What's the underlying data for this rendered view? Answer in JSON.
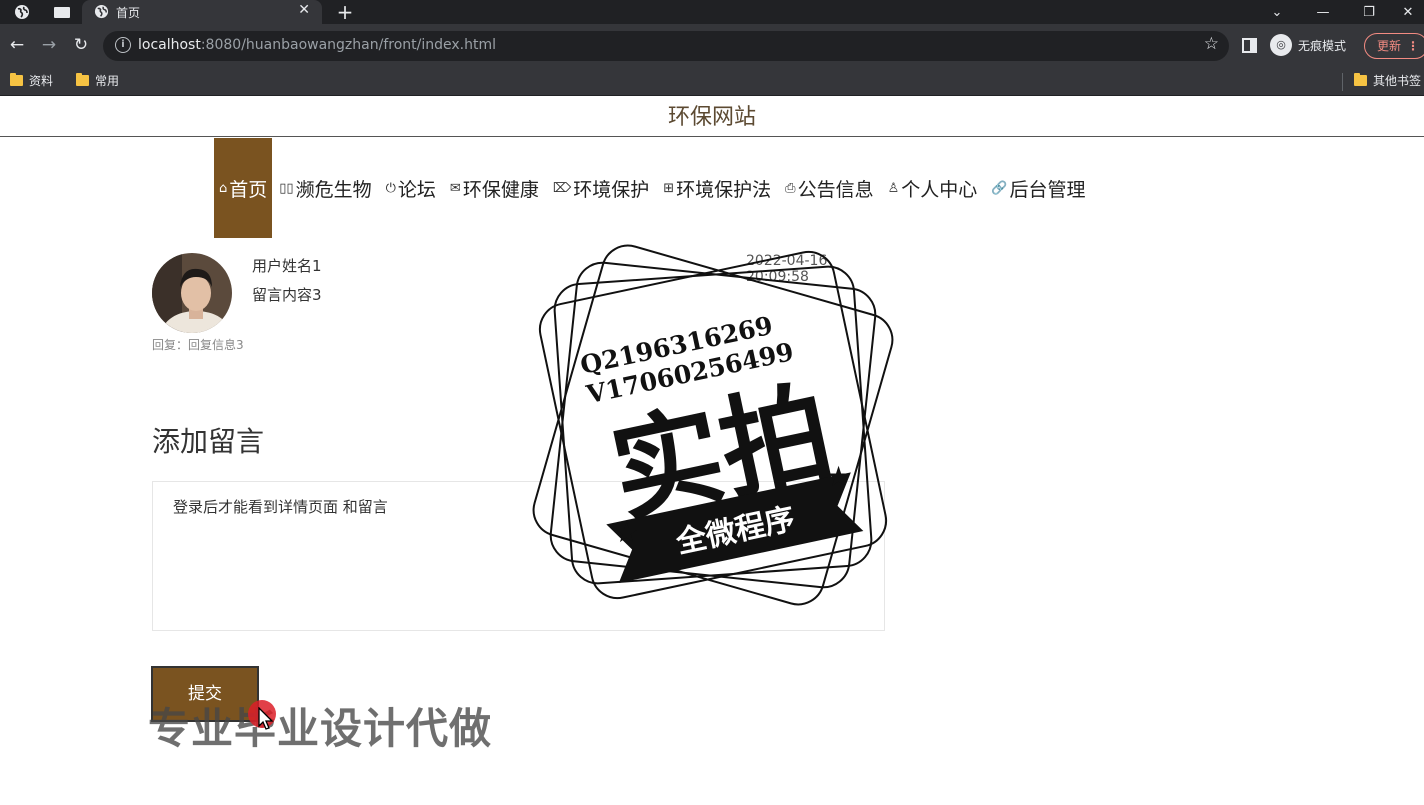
{
  "browser": {
    "tab_title": "首页",
    "url_host": "localhost",
    "url_rest": ":8080/huanbaowangzhan/front/index.html",
    "incognito_label": "无痕模式",
    "update_label": "更新",
    "bookmarks": [
      "资料",
      "常用"
    ],
    "other_bookmarks": "其他书签"
  },
  "site": {
    "title": "环保网站",
    "nav": [
      {
        "label": "首页",
        "icon": "home-icon",
        "glyph": "⌂"
      },
      {
        "label": "濒危生物",
        "icon": "grid-icon",
        "glyph": "▯▯"
      },
      {
        "label": "论坛",
        "icon": "power-icon",
        "glyph": "⏻"
      },
      {
        "label": "环保健康",
        "icon": "mail-icon",
        "glyph": "✉"
      },
      {
        "label": "环境保护",
        "icon": "tag-icon",
        "glyph": "⌦"
      },
      {
        "label": "环境保护法",
        "icon": "apps-icon",
        "glyph": "⊞"
      },
      {
        "label": "公告信息",
        "icon": "print-icon",
        "glyph": "⎙"
      },
      {
        "label": "个人中心",
        "icon": "user-icon",
        "glyph": "♙"
      },
      {
        "label": "后台管理",
        "icon": "link-icon",
        "glyph": "🔗"
      }
    ]
  },
  "comment": {
    "user": "用户姓名1",
    "content": "留言内容3",
    "time": "2022-04-16 20:09:58",
    "reply": "回复：回复信息3"
  },
  "form": {
    "title": "添加留言",
    "message_text": "登录后才能看到详情页面 和留言",
    "submit_label": "提交"
  },
  "overlay": {
    "stamp_line1": "Q2196316269",
    "stamp_line2": "V17060256499",
    "stamp_main": "实拍",
    "stamp_banner": "全微程序",
    "watermark": "专业毕业设计代做"
  },
  "colors": {
    "accent": "#7a5320",
    "chrome_dark": "#202124",
    "chrome": "#35363a"
  }
}
